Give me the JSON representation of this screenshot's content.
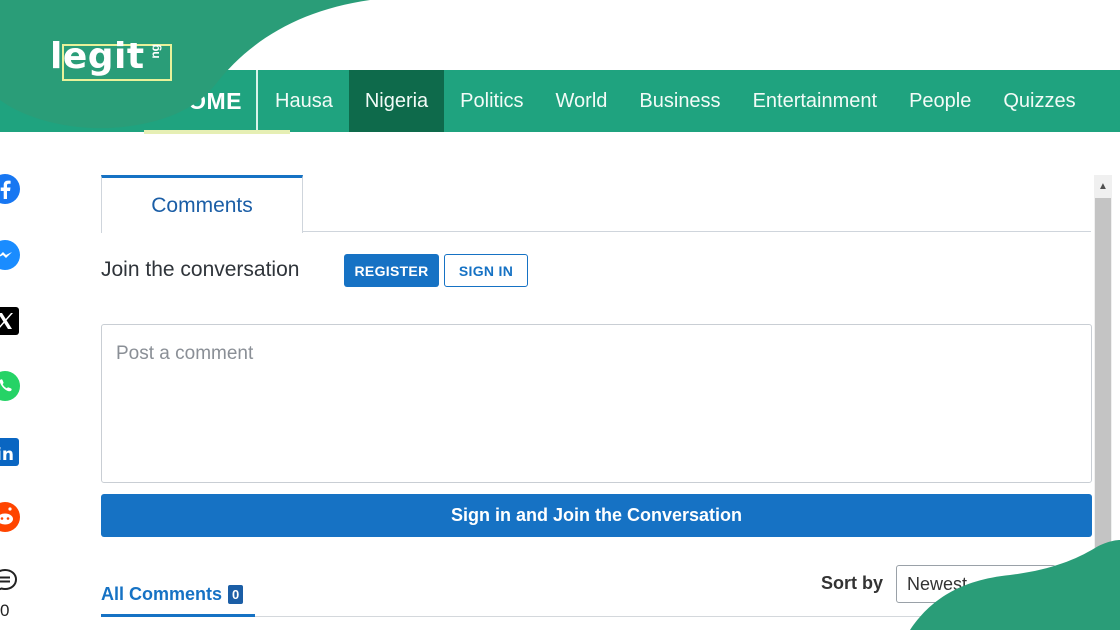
{
  "brand": {
    "logo_text": "legit",
    "logo_suffix": "ng"
  },
  "nav": {
    "home_label": "OME",
    "items": [
      {
        "label": "Hausa",
        "active": false
      },
      {
        "label": "Nigeria",
        "active": true
      },
      {
        "label": "Politics",
        "active": false
      },
      {
        "label": "World",
        "active": false
      },
      {
        "label": "Business",
        "active": false
      },
      {
        "label": "Entertainment",
        "active": false
      },
      {
        "label": "People",
        "active": false
      },
      {
        "label": "Quizzes",
        "active": false
      }
    ]
  },
  "share": {
    "icons": [
      "facebook-icon",
      "messenger-icon",
      "x-icon",
      "whatsapp-icon",
      "linkedin-icon",
      "reddit-icon",
      "comment-icon"
    ],
    "comment_count": "0"
  },
  "comments": {
    "tab_label": "Comments",
    "join_text": "Join the conversation",
    "register_label": "REGISTER",
    "signin_label": "SIGN IN",
    "placeholder": "Post a comment",
    "submit_label": "Sign in and Join the Conversation",
    "all_comments_label": "All Comments",
    "all_comments_count": "0",
    "sort_label": "Sort by",
    "sort_value": "Newest"
  },
  "colors": {
    "brand_green": "#1fa37f",
    "nav_active": "#0e6a4b",
    "accent_blue": "#1672c4"
  }
}
